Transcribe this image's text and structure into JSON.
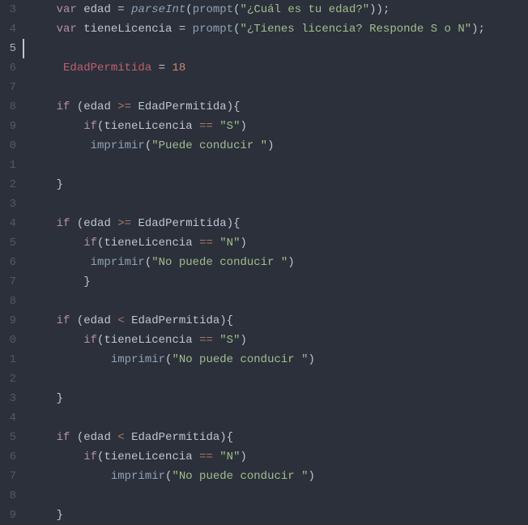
{
  "gutter_numbers": [
    "3",
    "4",
    "5",
    "6",
    "7",
    "8",
    "9",
    "0",
    "1",
    "2",
    "3",
    "4",
    "5",
    "6",
    "7",
    "8",
    "9",
    "0",
    "1",
    "2",
    "3",
    "4",
    "5",
    "6",
    "7",
    "8",
    "9"
  ],
  "active_line_index": 2,
  "code": {
    "l3": {
      "kw": "var",
      "v1": "edad",
      "eq": "=",
      "fn": "parseInt",
      "fn2": "prompt",
      "str": "\"¿Cuál es tu edad?\"",
      "end": ");",
      "mid": "(",
      "mid2": "(",
      "close": "))"
    },
    "l4": {
      "kw": "var",
      "v1": "tieneLicencia",
      "eq": "=",
      "fn2": "prompt",
      "str": "\"¿Tienes licencia? Responde S o N\"",
      "open": "(",
      "close": ");"
    },
    "l6": {
      "id": "EdadPermitida",
      "eq": "=",
      "num": "18"
    },
    "l8": {
      "kw": "if",
      "open": "(",
      "v1": "edad",
      "cmp": ">=",
      "v2": "EdadPermitida",
      "close": "){"
    },
    "l9": {
      "kw": "if",
      "open": "(",
      "v1": "tieneLicencia",
      "cmp": "==",
      "str": "\"S\"",
      "close": ")"
    },
    "l10": {
      "fn": "imprimir",
      "open": "(",
      "str": "\"Puede conducir \"",
      "close": ")"
    },
    "l12": {
      "brace": "}"
    },
    "l14": {
      "kw": "if",
      "open": "(",
      "v1": "edad",
      "cmp": ">=",
      "v2": "EdadPermitida",
      "close": "){"
    },
    "l15": {
      "kw": "if",
      "open": "(",
      "v1": "tieneLicencia",
      "cmp": "==",
      "str": "\"N\"",
      "close": ")"
    },
    "l16": {
      "fn": "imprimir",
      "open": "(",
      "str": "\"No puede conducir \"",
      "close": ")"
    },
    "l17": {
      "brace": "}"
    },
    "l19": {
      "kw": "if",
      "open": "(",
      "v1": "edad",
      "cmp": "<",
      "v2": "EdadPermitida",
      "close": "){"
    },
    "l20": {
      "kw": "if",
      "open": "(",
      "v1": "tieneLicencia",
      "cmp": "==",
      "str": "\"S\"",
      "close": ")"
    },
    "l21": {
      "fn": "imprimir",
      "open": "(",
      "str": "\"No puede conducir \"",
      "close": ")"
    },
    "l23": {
      "brace": "}"
    },
    "l25": {
      "kw": "if",
      "open": "(",
      "v1": "edad",
      "cmp": "<",
      "v2": "EdadPermitida",
      "close": "){"
    },
    "l26": {
      "kw": "if",
      "open": "(",
      "v1": "tieneLicencia",
      "cmp": "==",
      "str": "\"N\"",
      "close": ")"
    },
    "l27": {
      "fn": "imprimir",
      "open": "(",
      "str": "\"No puede conducir \"",
      "close": ")"
    },
    "l29": {
      "brace": "}"
    }
  }
}
